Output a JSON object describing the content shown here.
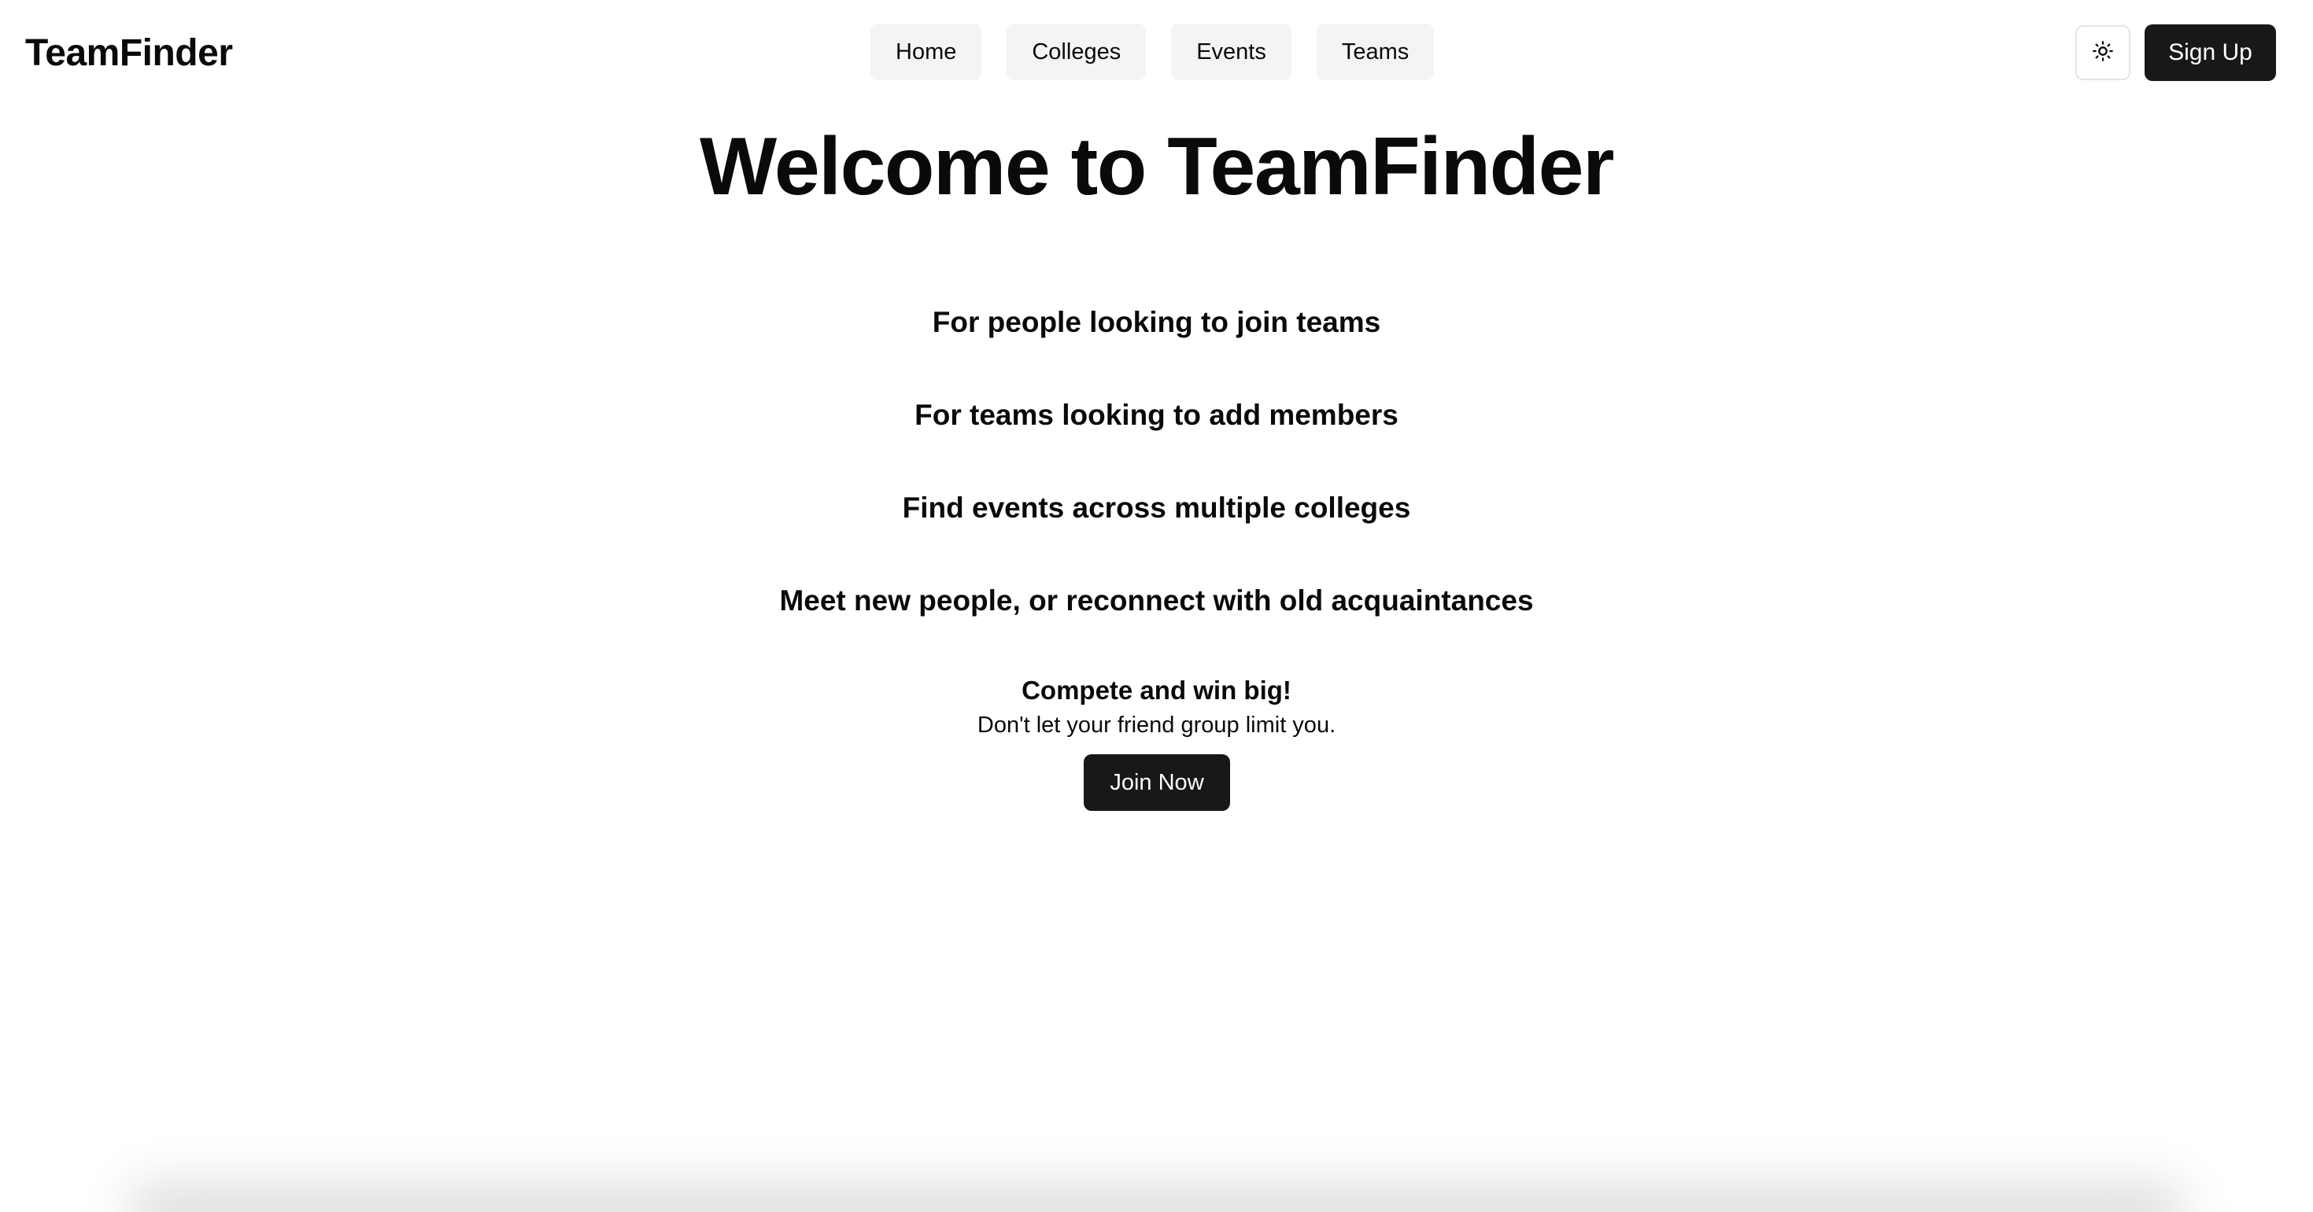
{
  "header": {
    "brand": "TeamFinder",
    "nav": [
      {
        "label": "Home"
      },
      {
        "label": "Colleges"
      },
      {
        "label": "Events"
      },
      {
        "label": "Teams"
      }
    ],
    "theme_toggle_icon": "sun-icon",
    "signup_label": "Sign Up"
  },
  "main": {
    "title": "Welcome to TeamFinder",
    "features": [
      "For people looking to join teams",
      "For teams looking to add members",
      "Find events across multiple colleges",
      "Meet new people, or reconnect with old acquaintances"
    ],
    "cta": {
      "heading": "Compete and win big!",
      "subtext": "Don't let your friend group limit you.",
      "button_label": "Join Now"
    }
  },
  "colors": {
    "background": "#ffffff",
    "text": "#0a0a0a",
    "primary_button": "#18181b",
    "nav_item_bg": "#f4f4f5"
  }
}
